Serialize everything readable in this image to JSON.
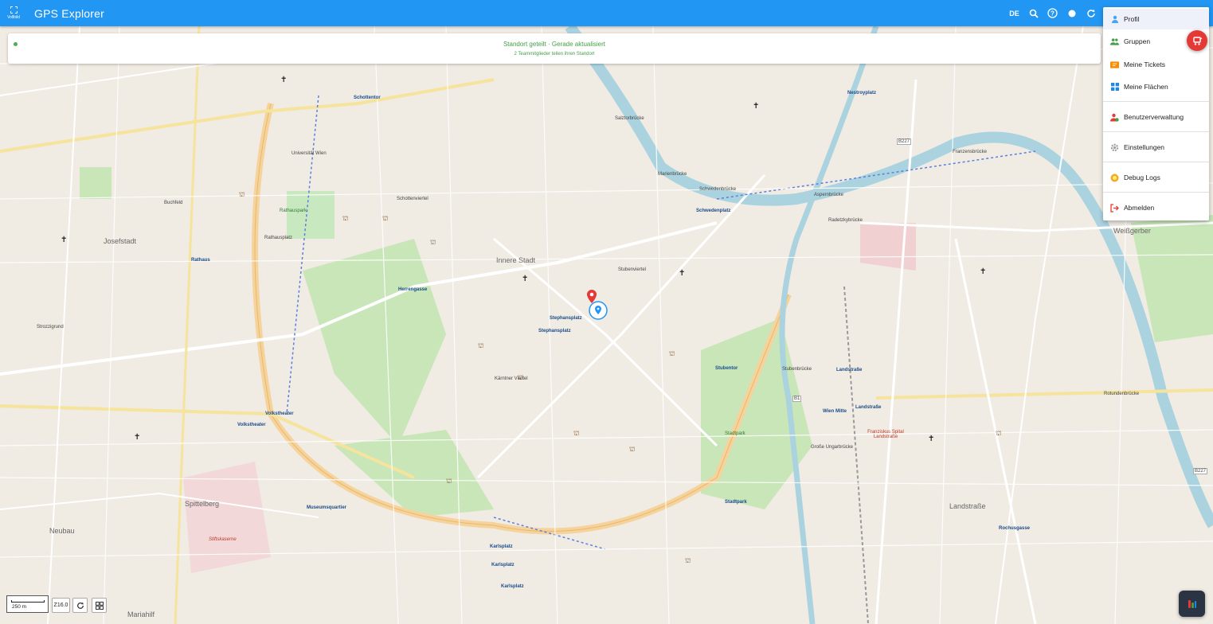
{
  "app": {
    "title": "GPS Explorer",
    "fullscreen_label": "Vollbild"
  },
  "toolbar": {
    "language": "DE"
  },
  "status": {
    "main": "Standort geteilt · Gerade aktualisiert",
    "sub": "2 Teammitglieder teilen ihren Standort"
  },
  "menu": {
    "items": [
      {
        "label": "Profil",
        "icon": "person-icon",
        "color": "#42a5f5"
      },
      {
        "label": "Gruppen",
        "icon": "group-icon",
        "color": "#43a047"
      },
      {
        "label": "Meine Tickets",
        "icon": "ticket-icon",
        "color": "#fb8c00"
      },
      {
        "label": "Meine Flächen",
        "icon": "grid-icon",
        "color": "#1e88e5"
      },
      {
        "label": "Benutzerverwaltung",
        "icon": "user-admin-icon",
        "color": "#e53935"
      },
      {
        "label": "Einstellungen",
        "icon": "gear-icon",
        "color": "#9e9e9e"
      },
      {
        "label": "Debug Logs",
        "icon": "bug-icon",
        "color": "#f9a825"
      },
      {
        "label": "Abmelden",
        "icon": "logout-icon",
        "color": "#e53935"
      }
    ]
  },
  "map": {
    "scale": "250 m",
    "zoom": "Z16.0",
    "labels": {
      "innere_stadt": "Innere Stadt",
      "stephansplatz": "Stephansplatz",
      "schottentor": "Schottentor",
      "rathaus": "Rathaus",
      "rathausplatz": "Rathausplatz",
      "rathauspark": "Rathauspark",
      "herrengasse": "Herrengasse",
      "volkstheater": "Volkstheater",
      "museumsquartier": "Museumsquartier",
      "karlsplatz": "Karlsplatz",
      "stubentor": "Stubentor",
      "stadtpark": "Stadtpark",
      "landstrasse": "Landstraße",
      "wien_mitte": "Wien Mitte",
      "schwedenplatz": "Schwedenplatz",
      "schwedenbruecke": "Schwedenbrücke",
      "marienbruecke": "Marienbrücke",
      "salztorbruecke": "Salztorbrücke",
      "aspernbruecke": "Aspernbrücke",
      "radetzkybruecke": "Radetzkybrücke",
      "nestroyplatz": "Nestroyplatz",
      "stubenbruecke": "Stubenbrücke",
      "josefstadt": "Josefstadt",
      "spittelberg": "Spittelberg",
      "neubau": "Neubau",
      "mariahilf": "Mariahilf",
      "weissgerber": "Weißgerber",
      "rochusgasse": "Rochusgasse",
      "kaerntner_viertel": "Kärntner Viertel",
      "stubenviertel": "Stubenviertel",
      "schottenviertel": "Schottenviertel",
      "stiftskaserne": "Stiftskaserne",
      "franzensbruecke": "Franzensbrücke",
      "rotundenbruecke": "Rotundenbrücke",
      "grosse_ungarbruecke": "Große Ungarbrücke",
      "buchfeld": "Buchfeld",
      "strozzigrund": "Strozzigrund",
      "franziskus": "Franziskus Spital Landstraße",
      "universitaet": "Universität Wien",
      "b227": "B227",
      "b1": "B1"
    }
  }
}
